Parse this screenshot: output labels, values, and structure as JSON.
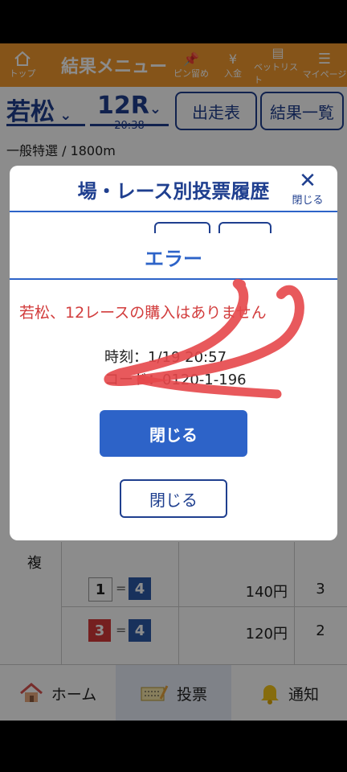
{
  "header": {
    "title": "結果メニュー",
    "items": [
      {
        "label": "トップ",
        "icon": "home-icon"
      },
      {
        "label": "ピン留め",
        "icon": "pin-icon"
      },
      {
        "label": "入金",
        "icon": "deposit-icon"
      },
      {
        "label": "ベットリスト",
        "icon": "betlist-icon"
      },
      {
        "label": "マイページ",
        "icon": "menu-icon"
      }
    ]
  },
  "race": {
    "venue": "若松",
    "number": "12R",
    "time": "20:38",
    "entries_button": "出走表",
    "results_button": "結果一覧",
    "info": "一般特選 / 1800m"
  },
  "history_modal": {
    "title": "場・レース別投票履歴",
    "close_label": "閉じる",
    "close_button": "閉じる"
  },
  "error_modal": {
    "title": "エラー",
    "message": "若松、12レースの購入はありません",
    "time_line": "時刻：1/19 20:57",
    "code_line": "コード：0120-1-196",
    "close_button": "閉じる"
  },
  "table": {
    "row_label": "複",
    "rows": [
      {
        "a": "1",
        "b": "4",
        "amount": "140円",
        "rank": "3"
      },
      {
        "a": "3",
        "b": "4",
        "amount": "120円",
        "rank": "2"
      }
    ]
  },
  "tabs": [
    {
      "label": "ホーム",
      "icon": "home-icon"
    },
    {
      "label": "投票",
      "icon": "ticket-icon"
    },
    {
      "label": "通知",
      "icon": "bell-icon"
    }
  ],
  "colors": {
    "header": "#f29a2e",
    "primary": "#2d63c8",
    "navy": "#1f3f8f",
    "error_text": "#d23c3c",
    "annotation": "#e6474a"
  }
}
